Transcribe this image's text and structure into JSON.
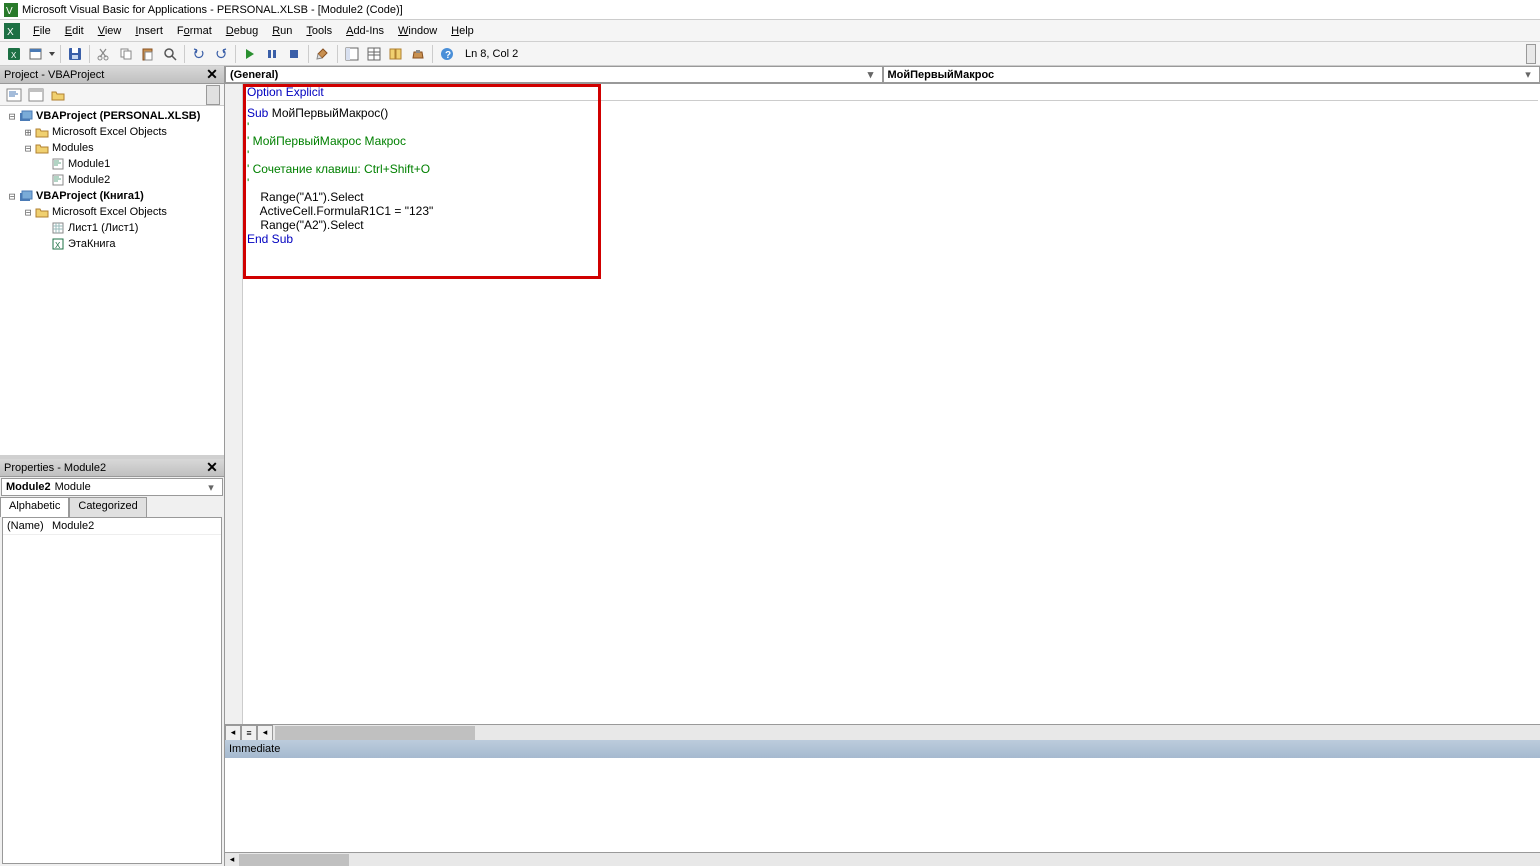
{
  "titlebar": {
    "text": "Microsoft Visual Basic for Applications - PERSONAL.XLSB - [Module2 (Code)]"
  },
  "menubar": {
    "items": [
      "File",
      "Edit",
      "View",
      "Insert",
      "Format",
      "Debug",
      "Run",
      "Tools",
      "Add-Ins",
      "Window",
      "Help"
    ]
  },
  "toolbar": {
    "status": "Ln 8, Col 2"
  },
  "project": {
    "title": "Project - VBAProject",
    "tree": {
      "vba1": "VBAProject (PERSONAL.XLSB)",
      "vba1_excel": "Microsoft Excel Objects",
      "vba1_modules": "Modules",
      "vba1_mod1": "Module1",
      "vba1_mod2": "Module2",
      "vba2": "VBAProject (Книга1)",
      "vba2_excel": "Microsoft Excel Objects",
      "vba2_sheet1": "Лист1 (Лист1)",
      "vba2_thisworkbook": "ЭтаКнига"
    }
  },
  "properties": {
    "title": "Properties - Module2",
    "object_name": "Module2",
    "object_type": "Module",
    "tabs": {
      "alphabetic": "Alphabetic",
      "categorized": "Categorized"
    },
    "row_name": "(Name)",
    "row_value": "Module2"
  },
  "code": {
    "selector_left": "(General)",
    "selector_right": "МойПервыйМакрос",
    "line1_option": "Option Explicit",
    "line3_sub": "Sub",
    "line3_name": " МойПервыйМакрос()",
    "line4": "'",
    "line5": "' МойПервыйМакрос Макрос",
    "line6": "'",
    "line7": "' Сочетание клавиш: Ctrl+Shift+O",
    "line8": "'",
    "line9": "    Range(\"A1\").Select",
    "line10": "    ActiveCell.FormulaR1C1 = \"123\"",
    "line11": "    Range(\"A2\").Select",
    "line12_end": "End Sub"
  },
  "immediate": {
    "title": "Immediate"
  }
}
